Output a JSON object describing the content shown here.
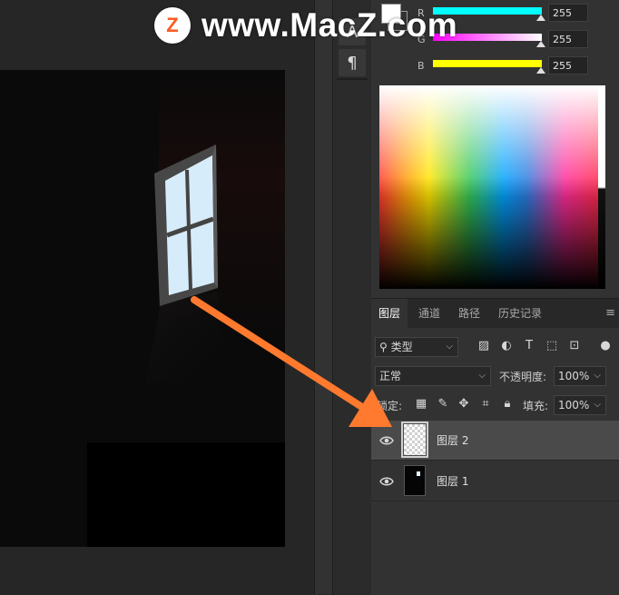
{
  "watermark": {
    "logo_letter": "Z",
    "text": "www.MacZ.com"
  },
  "mini_panel": {
    "tool_1_glyph": "A",
    "tool_2_glyph": "¶"
  },
  "color_panel": {
    "channels": [
      {
        "label": "R",
        "value": "255",
        "color": "#00ffff"
      },
      {
        "label": "G",
        "value": "255",
        "color": "#ff00ff"
      },
      {
        "label": "B",
        "value": "255",
        "color": "#ffff00"
      }
    ],
    "foreground_color": "#ffffff"
  },
  "layers_panel": {
    "tabs": [
      "图层",
      "通道",
      "路径",
      "历史记录"
    ],
    "active_tab": "图层",
    "filter_kind": "类型",
    "blend_mode": "正常",
    "opacity_label": "不透明度:",
    "opacity_value": "100%",
    "lock_label": "锁定:",
    "fill_label": "填充:",
    "fill_value": "100%",
    "layers": [
      {
        "name": "图层 2",
        "selected": true,
        "visible": true,
        "thumbnail": "transparent"
      },
      {
        "name": "图层 1",
        "selected": false,
        "visible": true,
        "thumbnail": "dark-room"
      }
    ]
  },
  "annotation": {
    "arrow_color": "#ff7a2e"
  }
}
